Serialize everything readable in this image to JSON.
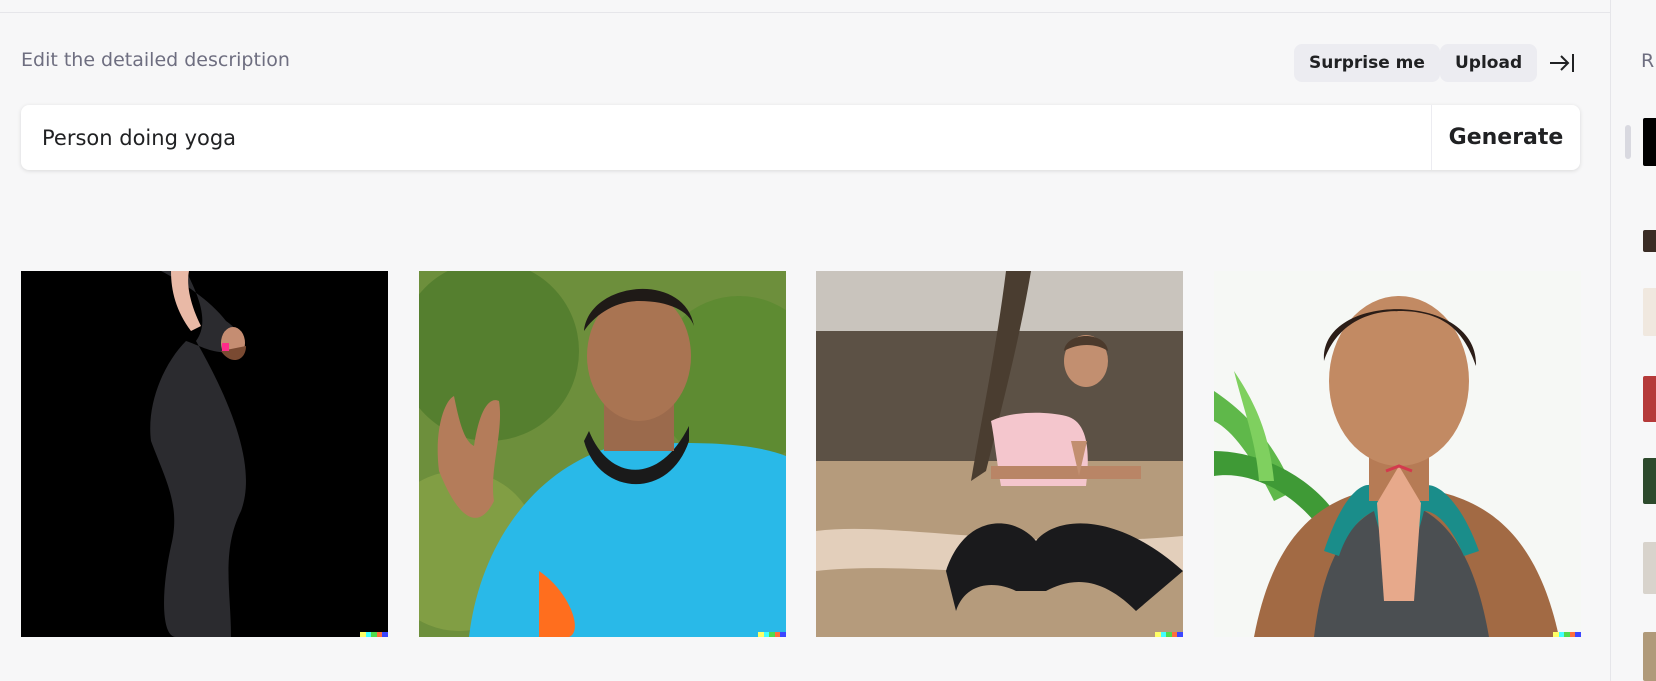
{
  "header": {
    "description_label": "Edit the detailed description",
    "surprise_label": "Surprise me",
    "upload_label": "Upload"
  },
  "prompt": {
    "value": "Person doing yoga",
    "generate_label": "Generate"
  },
  "results": [
    {
      "subject": "woman in black leggings doing a backbend on black background"
    },
    {
      "subject": "young man in blue t-shirt smiling with raised palm"
    },
    {
      "subject": "man in pink shirt kneeling with palms together outdoors"
    },
    {
      "subject": "girl with closed eyes and hands in prayer"
    }
  ],
  "sidebar": {
    "history_label": "R"
  },
  "colors": {
    "background": "#f7f7f8",
    "button_bg": "#ececf1",
    "text": "#202123",
    "muted": "#6e6e80",
    "signature": [
      "#ffff66",
      "#42ffff",
      "#51da4c",
      "#ff6e3c",
      "#3c46ff"
    ]
  },
  "icons": {
    "collapse": "arrow-right-to-line-icon"
  }
}
